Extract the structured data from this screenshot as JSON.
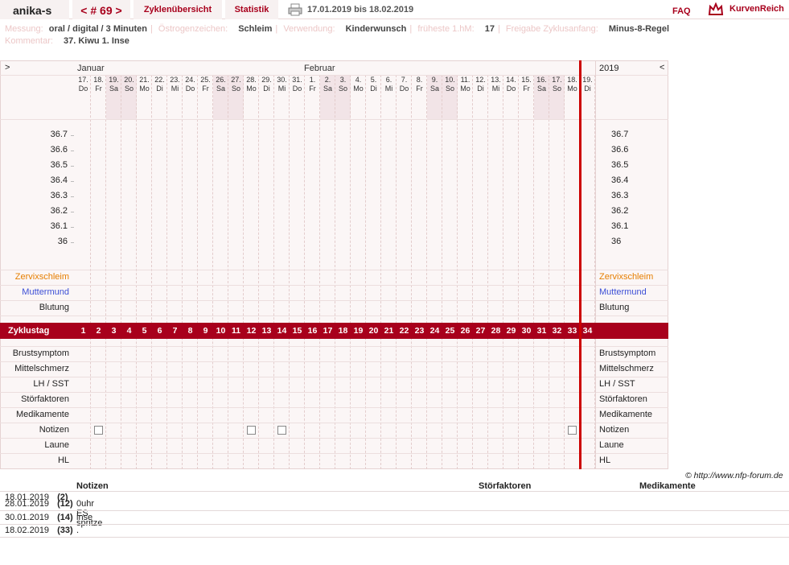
{
  "header": {
    "user": "anika-s",
    "cycle_nav": "< # 69 >",
    "tab_overview": "Zyklenübersicht",
    "tab_stats": "Statistik",
    "date_range": "17.01.2019 bis 18.02.2019",
    "faq": "FAQ",
    "logo_text": "KurvenReich",
    "accent_color": "#a8001c"
  },
  "meta": {
    "messung_label": "Messung:",
    "messung": "oral / digital / 3 Minuten",
    "oestro_label": "Östrogenzeichen:",
    "oestro": "Schleim",
    "verwendung_label": "Verwendung:",
    "verwendung": "Kinderwunsch",
    "fruehe_label": "früheste 1.hM:",
    "fruehe": "17",
    "freigabe_label": "Freigabe Zyklusanfang:",
    "freigabe": "Minus-8-Regel",
    "kommentar_label": "Kommentar:",
    "kommentar": "37. Kiwu 1. Inse"
  },
  "chart": {
    "nav_prev": ">",
    "nav_next": "<",
    "year": "2019",
    "months": [
      {
        "name": "Januar",
        "day_index": 0
      },
      {
        "name": "Februar",
        "day_index": 16
      }
    ],
    "days": [
      {
        "d": "17.",
        "w": "Do"
      },
      {
        "d": "18.",
        "w": "Fr"
      },
      {
        "d": "19.",
        "w": "Sa"
      },
      {
        "d": "20.",
        "w": "So"
      },
      {
        "d": "21.",
        "w": "Mo"
      },
      {
        "d": "22.",
        "w": "Di"
      },
      {
        "d": "23.",
        "w": "Mi"
      },
      {
        "d": "24.",
        "w": "Do"
      },
      {
        "d": "25.",
        "w": "Fr"
      },
      {
        "d": "26.",
        "w": "Sa"
      },
      {
        "d": "27.",
        "w": "So"
      },
      {
        "d": "28.",
        "w": "Mo"
      },
      {
        "d": "29.",
        "w": "Di"
      },
      {
        "d": "30.",
        "w": "Mi"
      },
      {
        "d": "31.",
        "w": "Do"
      },
      {
        "d": "1.",
        "w": "Fr"
      },
      {
        "d": "2.",
        "w": "Sa"
      },
      {
        "d": "3.",
        "w": "So"
      },
      {
        "d": "4.",
        "w": "Mo"
      },
      {
        "d": "5.",
        "w": "Di"
      },
      {
        "d": "6.",
        "w": "Mi"
      },
      {
        "d": "7.",
        "w": "Do"
      },
      {
        "d": "8.",
        "w": "Fr"
      },
      {
        "d": "9.",
        "w": "Sa"
      },
      {
        "d": "10.",
        "w": "So"
      },
      {
        "d": "11.",
        "w": "Mo"
      },
      {
        "d": "12.",
        "w": "Di"
      },
      {
        "d": "13.",
        "w": "Mi"
      },
      {
        "d": "14.",
        "w": "Do"
      },
      {
        "d": "15.",
        "w": "Fr"
      },
      {
        "d": "16.",
        "w": "Sa"
      },
      {
        "d": "17.",
        "w": "So"
      },
      {
        "d": "18.",
        "w": "Mo"
      },
      {
        "d": "19.",
        "w": "Di"
      }
    ],
    "temps": [
      "36.7",
      "36.6",
      "36.5",
      "36.4",
      "36.3",
      "36.2",
      "36.1",
      "36"
    ],
    "rows_mid": [
      {
        "label": "Zervixschleim",
        "color": "#e67e00"
      },
      {
        "label": "Muttermund",
        "color": "#3c4fd6"
      },
      {
        "label": "Blutung",
        "color": "#222"
      }
    ],
    "zyklustag_label": "Zyklustag",
    "zyklustage": [
      "1",
      "2",
      "3",
      "4",
      "5",
      "6",
      "7",
      "8",
      "9",
      "10",
      "11",
      "12",
      "13",
      "14",
      "15",
      "16",
      "17",
      "18",
      "19",
      "20",
      "21",
      "22",
      "23",
      "24",
      "25",
      "26",
      "27",
      "28",
      "29",
      "30",
      "31",
      "32",
      "33",
      "34"
    ],
    "rows_low": [
      "Brustsymptom",
      "Mittelschmerz",
      "LH / SST",
      "Störfaktoren",
      "Medikamente",
      "Notizen",
      "Laune",
      "HL"
    ],
    "note_days": [
      2,
      12,
      14,
      33
    ]
  },
  "footer": {
    "copyright": "© http://www.nfp-forum.de"
  },
  "table": {
    "headers": {
      "notizen": "Notizen",
      "stoer": "Störfaktoren",
      "medi": "Medikamente"
    },
    "rows": [
      {
        "date": "18.01.2019",
        "tag": "(2)",
        "note": ""
      },
      {
        "date": "28.01.2019",
        "tag": "(12)",
        "note": "0uhr ES spritze"
      },
      {
        "date": "30.01.2019",
        "tag": "(14)",
        "note": "inse"
      },
      {
        "date": "18.02.2019",
        "tag": "(33)",
        "note": "."
      }
    ]
  }
}
